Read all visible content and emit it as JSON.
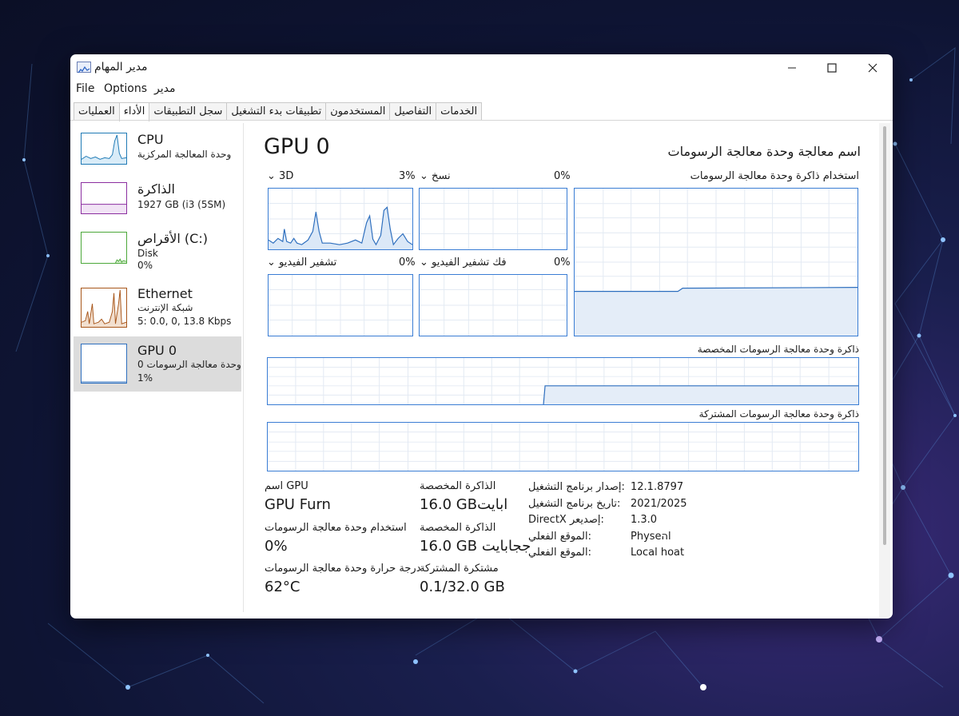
{
  "window": {
    "title": "مدير المهام"
  },
  "menu": [
    "File",
    "Options",
    "مدير"
  ],
  "tabs": [
    "العمليات",
    "الأداء",
    "سجل التطبيقات",
    "تطبيقات بدء التشغيل",
    "المستخدمون",
    "التفاصيل",
    "الخدمات"
  ],
  "active_tab": 1,
  "sidebar": [
    {
      "title": "CPU",
      "sub1": "وحدة المعالجة المركزية",
      "sub2": "",
      "color": "#1f7ab5"
    },
    {
      "title": "الذاكرة",
      "sub1": "1927 GB (i3 (5SM)",
      "sub2": "",
      "color": "#8b2fa0"
    },
    {
      "title": "الأقراص (C:)",
      "sub1": "Disk",
      "sub2": "0%",
      "color": "#4ca83a"
    },
    {
      "title": "Ethernet",
      "sub1": "شبكة الإنترنت",
      "sub2": "5: 0.0, 0, 13.8 Kbps",
      "color": "#a8561a"
    },
    {
      "title": "GPU 0",
      "sub1": "وحدة معالجة الرسومات 0",
      "sub2": "1%",
      "color": "#2e6fbe"
    }
  ],
  "selected_item": 4,
  "main": {
    "title": "GPU 0",
    "gpu_name": "اسم معالجة وحدة معالجة الرسومات",
    "engines": [
      {
        "name": "3D",
        "pct": "3%",
        "icon": "chevron-down-icon"
      },
      {
        "name": "نسخ",
        "pct": "0%",
        "icon": "chevron-down-icon"
      },
      {
        "name": "تشفير الفيديو",
        "pct": "0%",
        "icon": "chevron-down-icon"
      },
      {
        "name": "فك تشفير الفيديو",
        "pct": "0%",
        "icon": "chevron-down-icon"
      }
    ],
    "big_graph_label": "استخدام ذاكرة وحدة معالجة الرسومات",
    "dedicated_label": "ذاكرة وحدة معالجة الرسومات المخصصة",
    "shared_label": "ذاكرة وحدة معالجة الرسومات المشتركة"
  },
  "stats": [
    {
      "label": "اسم GPU",
      "value": "GPU Furn"
    },
    {
      "label": "استخدام وحدة معالجة الرسومات",
      "value": "0%"
    },
    {
      "label": "درجة حرارة وحدة معالجة الرسومات",
      "value": "62°C"
    },
    {
      "label": "الذاكرة المخصصة",
      "value": "16.0 GBابايت"
    },
    {
      "label": "الذاكرة المخصصة",
      "value": "16.0 GB ججابايت"
    },
    {
      "label": "مشتكرة المشتركة",
      "value": "0.1/32.0 GB"
    }
  ],
  "info": [
    {
      "key": "إصدار برنامج التشغيل:",
      "value": "12.1.8797"
    },
    {
      "key": "تاريخ برنامج التشغيل:",
      "value": "2021/2025"
    },
    {
      "key": "DirectX إصديعر:",
      "value": "1.3.0"
    },
    {
      "key": "الموقع الفعلي:",
      "value": "Physeהl"
    },
    {
      "key": "الموقع الفعلي:",
      "value": "Local hoat"
    }
  ]
}
